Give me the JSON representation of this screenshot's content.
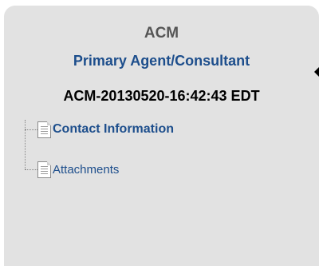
{
  "panel": {
    "title": "ACM",
    "subtitle": "Primary Agent/Consultant",
    "record_id": "ACM-20130520-16:42:43 EDT"
  },
  "tree": {
    "items": [
      {
        "label": "Contact Information",
        "icon": "document-icon",
        "bold": true
      },
      {
        "label": "Attachments",
        "icon": "document-icon",
        "bold": false
      }
    ]
  },
  "colors": {
    "panel_bg": "#e2e2e2",
    "link": "#1d4e8c",
    "title": "#555555"
  }
}
